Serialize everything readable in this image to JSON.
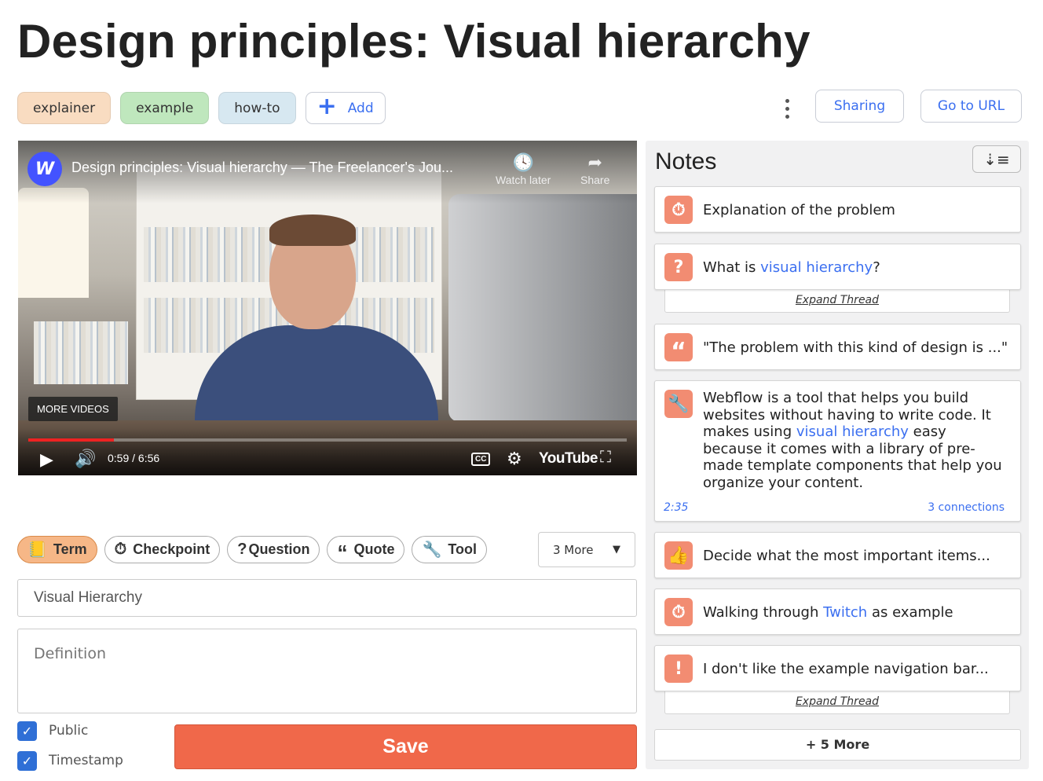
{
  "page": {
    "title": "Design principles: Visual hierarchy"
  },
  "tags": [
    {
      "label": "explainer",
      "color": "#f9dcc1"
    },
    {
      "label": "example",
      "color": "#bfe7bd"
    },
    {
      "label": "how-to",
      "color": "#d7e8f1"
    }
  ],
  "add_tag": {
    "icon": "plus-icon",
    "label": "Add"
  },
  "header_actions": {
    "menu_icon": "kebab-menu-icon",
    "sharing": "Sharing",
    "goto_url": "Go to URL"
  },
  "video": {
    "channel_logo": "W",
    "title": "Design principles: Visual hierarchy — The Freelancer's Jou...",
    "watch_later": "Watch later",
    "share": "Share",
    "more_videos": "MORE VIDEOS",
    "time": "0:59 / 6:56",
    "progress": 0.143,
    "brand": "YouTube",
    "cc": "CC"
  },
  "notes": {
    "title": "Notes",
    "sort_icon": "sort-descending-icon",
    "items": [
      {
        "icon": "stopwatch-icon",
        "text": "Explanation of the problem"
      },
      {
        "icon": "question-icon",
        "text_before": "What is ",
        "link": "visual hierarchy",
        "text_after": "?",
        "expand": "Expand Thread"
      },
      {
        "icon": "quote-icon",
        "text": "\"The problem with this kind of design is ...\""
      },
      {
        "icon": "wrench-icon",
        "text_before": "Webflow is a tool that helps you build websites without having to write code. It makes using ",
        "link": "visual hierarchy",
        "text_after": " easy because it comes with a library of pre-made template components that help you organize your content.",
        "timestamp": "2:35",
        "connections": "3 connections"
      },
      {
        "icon": "thumbs-up-icon",
        "text": "Decide what the most important items..."
      },
      {
        "icon": "stopwatch-icon",
        "text_before": "Walking through ",
        "link": "Twitch",
        "text_after": " as example"
      },
      {
        "icon": "exclamation-icon",
        "text": "I don't like the example navigation bar...",
        "expand": "Expand Thread"
      }
    ],
    "more": "+ 5 More"
  },
  "note_types": [
    {
      "label": "Term",
      "icon": "book-icon",
      "active": true
    },
    {
      "label": "Checkpoint",
      "icon": "stopwatch-icon"
    },
    {
      "label": "Question",
      "icon": "question-icon"
    },
    {
      "label": "Quote",
      "icon": "quote-icon"
    },
    {
      "label": "Tool",
      "icon": "wrench-icon"
    }
  ],
  "more_types": "3 More",
  "form": {
    "term_value": "Visual Hierarchy",
    "definition_placeholder": "Definition",
    "public_label": "Public",
    "public_checked": true,
    "timestamp_label": "Timestamp",
    "timestamp_checked": true,
    "save_label": "Save"
  },
  "colors": {
    "accent": "#3b6ff0",
    "save": "#f0684a",
    "note_icon": "#f28c72",
    "active_type": "#f6b787"
  }
}
